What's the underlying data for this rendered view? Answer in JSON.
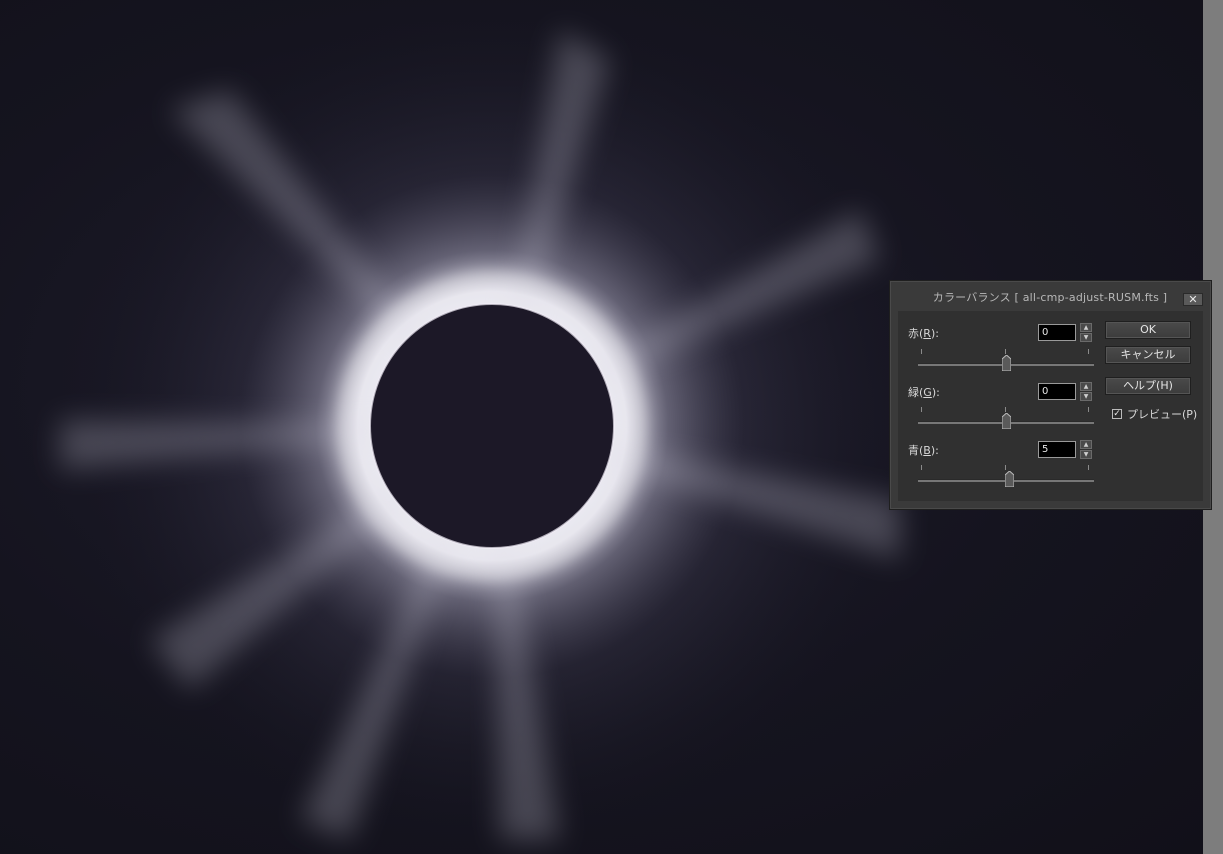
{
  "dialog": {
    "title": "カラーバランス [ all-cmp-adjust-RUSM.fts ]",
    "close_glyph": "✕",
    "red": {
      "label": "赤(",
      "mnemonic": "R",
      "suffix": "):",
      "value": "0",
      "level": 0.5
    },
    "green": {
      "label": "緑(",
      "mnemonic": "G",
      "suffix": "):",
      "value": "0",
      "level": 0.5
    },
    "blue": {
      "label": "青(",
      "mnemonic": "B",
      "suffix": "):",
      "value": "5",
      "level": 0.52
    },
    "ok_label": "OK",
    "cancel_label": "キャンセル",
    "help_label": "ヘルプ(H)",
    "preview_label": "プレビュー(P)",
    "preview_checked": true,
    "check_glyph": "✓"
  },
  "icons": {
    "spin_up": "▲",
    "spin_down": "▼"
  }
}
